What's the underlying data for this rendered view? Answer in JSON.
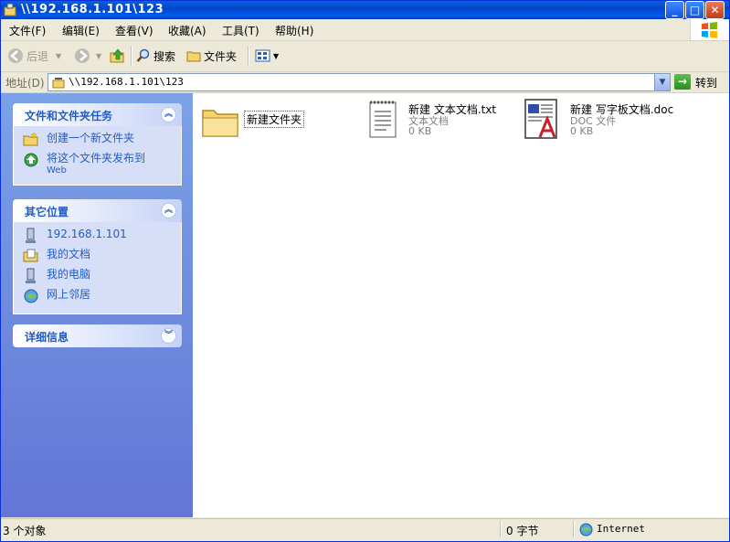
{
  "window": {
    "title": "\\\\192.168.1.101\\123",
    "minimize": "_",
    "maximize": "□",
    "close": "✕"
  },
  "menu": [
    {
      "label": "文件(F)"
    },
    {
      "label": "编辑(E)"
    },
    {
      "label": "查看(V)"
    },
    {
      "label": "收藏(A)"
    },
    {
      "label": "工具(T)"
    },
    {
      "label": "帮助(H)"
    }
  ],
  "toolbar": {
    "back_label": "后退",
    "search_label": "搜索",
    "folders_label": "文件夹"
  },
  "address": {
    "label": "地址(D)",
    "value": "\\\\192.168.1.101\\123",
    "go_label": "转到"
  },
  "tasks_panel": {
    "title": "文件和文件夹任务",
    "items": [
      {
        "label": "创建一个新文件夹",
        "icon": "new-folder-icon"
      },
      {
        "label": "将这个文件夹发布到",
        "sub": "Web",
        "icon": "publish-web-icon"
      }
    ]
  },
  "places_panel": {
    "title": "其它位置",
    "items": [
      {
        "label": "192.168.1.101",
        "icon": "network-computer-icon"
      },
      {
        "label": "我的文档",
        "icon": "my-documents-icon"
      },
      {
        "label": "我的电脑",
        "icon": "my-computer-icon"
      },
      {
        "label": "网上邻居",
        "icon": "network-places-icon"
      }
    ]
  },
  "details_panel": {
    "title": "详细信息"
  },
  "files": [
    {
      "name": "新建文件夹",
      "type": "",
      "size": "",
      "icon": "folder-icon"
    },
    {
      "name": "新建 文本文档.txt",
      "type": "文本文档",
      "size": "0 KB",
      "icon": "text-document-icon"
    },
    {
      "name": "新建 写字板文档.doc",
      "type": "DOC 文件",
      "size": "0 KB",
      "icon": "wordpad-document-icon"
    }
  ],
  "status": {
    "count": "3 个对象",
    "bytes": "0 字节",
    "zone": "Internet"
  },
  "colors": {
    "titlebar": "#0054E3",
    "taskpane_link": "#215DC6",
    "taskpane_bg": "#6375D6"
  }
}
